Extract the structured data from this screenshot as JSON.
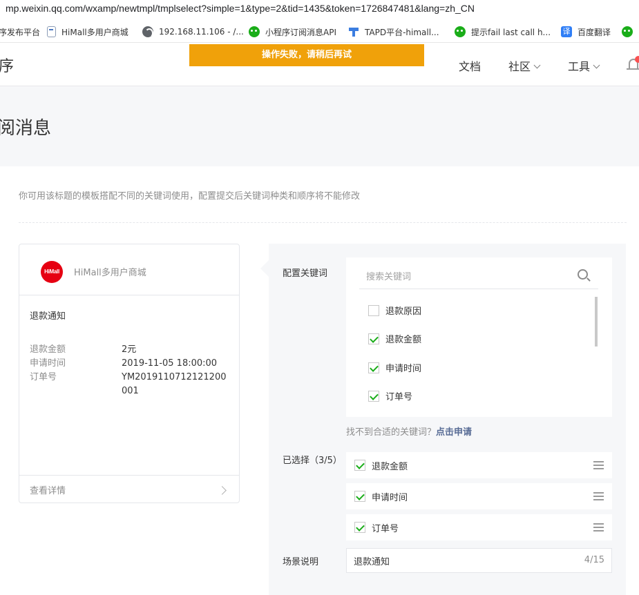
{
  "browser": {
    "url": "mp.weixin.qq.com/wxamp/newtmpl/tmplselect?simple=1&type=2&tid=1435&token=1726847481&lang=zh_CN",
    "bookmarks": [
      {
        "label": "序发布平台",
        "icon": "page-icon"
      },
      {
        "label": "HiMall多用户商城",
        "icon": "page-icon"
      },
      {
        "label": "192.168.11.106 - /...",
        "icon": "globe-icon"
      },
      {
        "label": "小程序订阅消息API",
        "icon": "wechat-icon"
      },
      {
        "label": "TAPD平台-himall...",
        "icon": "tapd-icon"
      },
      {
        "label": "提示fail last call h...",
        "icon": "wechat-icon"
      },
      {
        "label": "百度翻译",
        "icon": "translate-icon"
      }
    ],
    "translate_glyph": "译"
  },
  "topnav": {
    "brand": "序",
    "docs": "文档",
    "community": "社区",
    "tools": "工具"
  },
  "toast": "操作失败，请稍后再试",
  "page": {
    "title": "阅消息",
    "hint": "你可用该标题的模板搭配不同的关键词使用，配置提交后关键词种类和顺序将不能修改"
  },
  "preview": {
    "logo_text": "HiMall",
    "app_name": "HiMall多用户商城",
    "notice_title": "退款通知",
    "fields": [
      {
        "key": "退款金额",
        "value": "2元"
      },
      {
        "key": "申请时间",
        "value": "2019-11-05 18:00:00"
      },
      {
        "key": "订单号",
        "value": "YM2019110712121200001"
      }
    ],
    "detail_label": "查看详情"
  },
  "config": {
    "keywords_label": "配置关键词",
    "search_placeholder": "搜索关键词",
    "keywords": [
      {
        "label": "退款原因",
        "checked": false
      },
      {
        "label": "退款金额",
        "checked": true
      },
      {
        "label": "申请时间",
        "checked": true
      },
      {
        "label": "订单号",
        "checked": true
      }
    ],
    "not_found_text": "找不到合适的关键词？",
    "apply_link": "点击申请",
    "selected_label": "已选择（3/5）",
    "selected": [
      {
        "label": "退款金额",
        "checked": true
      },
      {
        "label": "申请时间",
        "checked": true
      },
      {
        "label": "订单号",
        "checked": true
      }
    ],
    "scene_label": "场景说明",
    "scene_value": "退款通知",
    "scene_count": "4/15"
  },
  "colors": {
    "toast": "#f0a10a",
    "check": "#1aad19",
    "link": "#576b95",
    "logo": "#e60012"
  }
}
